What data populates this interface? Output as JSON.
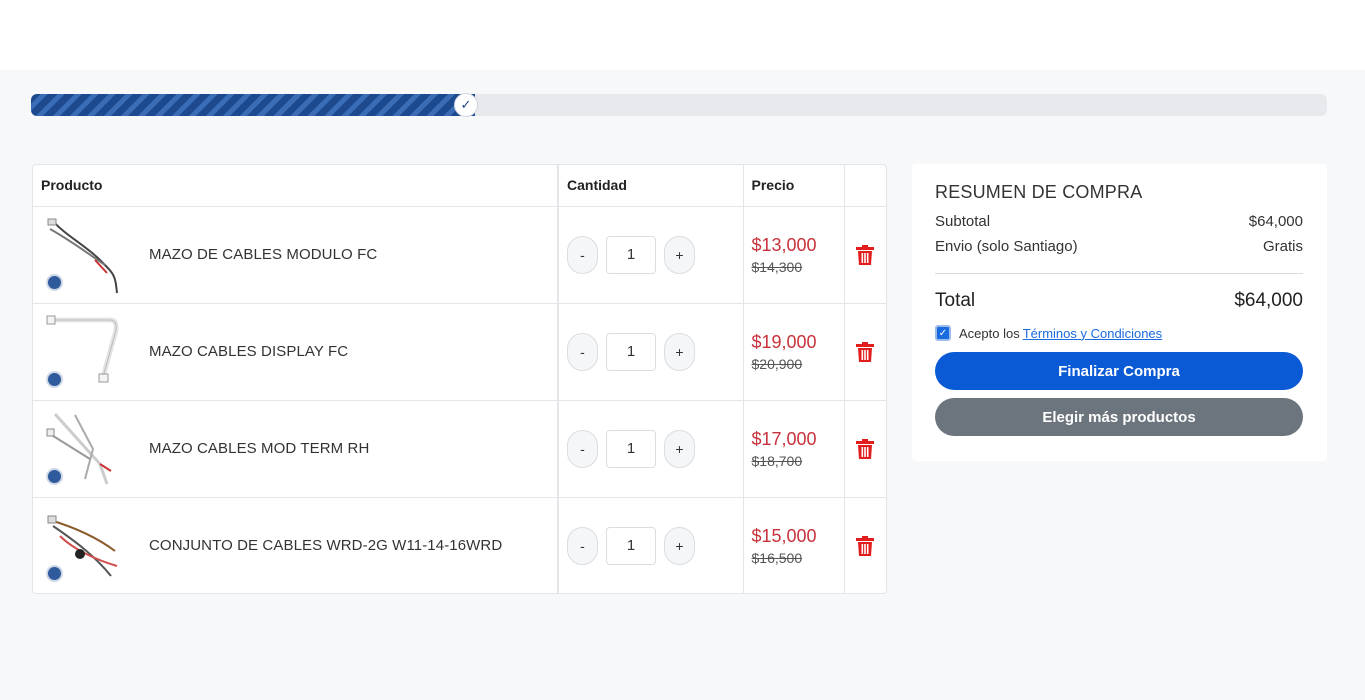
{
  "progress": {
    "fraction": 0.33,
    "knob_icon": "check-icon"
  },
  "table": {
    "headers": {
      "product": "Producto",
      "quantity": "Cantidad",
      "price": "Precio"
    },
    "rows": [
      {
        "name": "MAZO DE CABLES MODULO FC",
        "qty": "1",
        "price": "$13,000",
        "old_price": "$14,300"
      },
      {
        "name": "MAZO CABLES DISPLAY FC",
        "qty": "1",
        "price": "$19,000",
        "old_price": "$20,900"
      },
      {
        "name": "MAZO CABLES MOD TERM RH",
        "qty": "1",
        "price": "$17,000",
        "old_price": "$18,700"
      },
      {
        "name": "CONJUNTO DE CABLES WRD-2G W11-14-16WRD",
        "qty": "1",
        "price": "$15,000",
        "old_price": "$16,500"
      }
    ],
    "minus_label": "-",
    "plus_label": "+"
  },
  "summary": {
    "title": "RESUMEN DE COMPRA",
    "subtotal_label": "Subtotal",
    "subtotal_value": "$64,000",
    "shipping_label": "Envio (solo Santiago)",
    "shipping_value": "Gratis",
    "total_label": "Total",
    "total_value": "$64,000",
    "terms_prefix": "Acepto los",
    "terms_link": "Términos y Condiciones",
    "terms_checked": true,
    "checkout_button": "Finalizar Compra",
    "continue_button": "Elegir más productos"
  },
  "colors": {
    "accent": "#0a5ad6",
    "price": "#c8323b",
    "delete": "#e11d1d",
    "secondary": "#6c757d"
  }
}
